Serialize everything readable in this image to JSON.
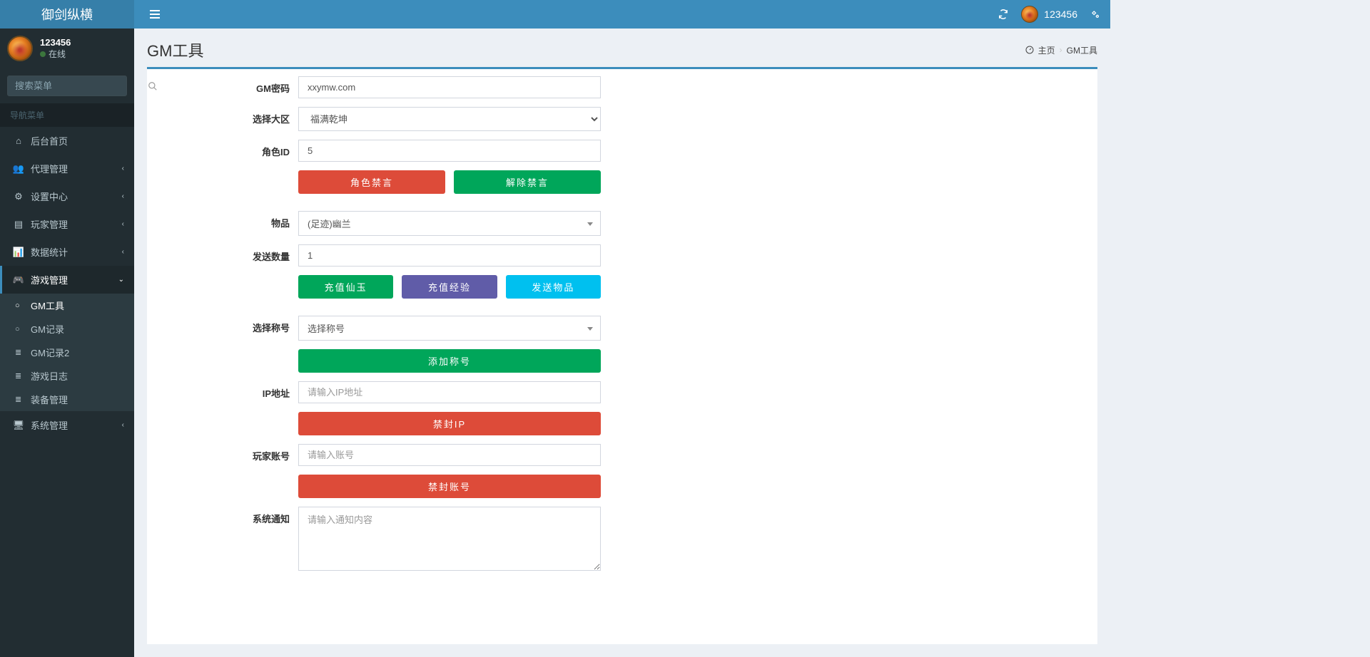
{
  "app_title": "御剑纵横",
  "user": {
    "name": "123456",
    "status": "在线"
  },
  "search_placeholder": "搜索菜单",
  "nav_header": "导航菜单",
  "sidebar": [
    {
      "icon": "dashboard",
      "label": "后台首页",
      "chev": ""
    },
    {
      "icon": "users",
      "label": "代理管理",
      "chev": "‹"
    },
    {
      "icon": "cogs",
      "label": "设置中心",
      "chev": "‹"
    },
    {
      "icon": "note",
      "label": "玩家管理",
      "chev": "‹"
    },
    {
      "icon": "chart",
      "label": "数据统计",
      "chev": "‹"
    },
    {
      "icon": "game",
      "label": "游戏管理",
      "chev": "⌄",
      "active": true,
      "children": [
        {
          "icon": "○",
          "label": "GM工具",
          "current": true
        },
        {
          "icon": "○",
          "label": "GM记录"
        },
        {
          "icon": "≣",
          "label": "GM记录2"
        },
        {
          "icon": "≣",
          "label": "游戏日志"
        },
        {
          "icon": "≣",
          "label": "装备管理"
        }
      ]
    },
    {
      "icon": "system",
      "label": "系统管理",
      "chev": "‹"
    }
  ],
  "topbar_user": "123456",
  "page_title": "GM工具",
  "breadcrumb": {
    "home": "主页",
    "current": "GM工具"
  },
  "form": {
    "gm_pw_label": "GM密码",
    "gm_pw_value": "xxymw.com",
    "zone_label": "选择大区",
    "zone_value": "福满乾坤",
    "role_label": "角色ID",
    "role_value": "5",
    "btn_ban": "角色禁言",
    "btn_unban": "解除禁言",
    "item_label": "物品",
    "item_value": "(足迹)幽兰",
    "qty_label": "发送数量",
    "qty_value": "1",
    "btn_jade": "充值仙玉",
    "btn_exp": "充值经验",
    "btn_send": "发送物品",
    "title_label": "选择称号",
    "title_value": "选择称号",
    "btn_add_title": "添加称号",
    "ip_label": "IP地址",
    "ip_placeholder": "请输入IP地址",
    "btn_ban_ip": "禁封IP",
    "account_label": "玩家账号",
    "account_placeholder": "请输入账号",
    "btn_ban_acc": "禁封账号",
    "notice_label": "系统通知",
    "notice_placeholder": "请输入通知内容"
  }
}
